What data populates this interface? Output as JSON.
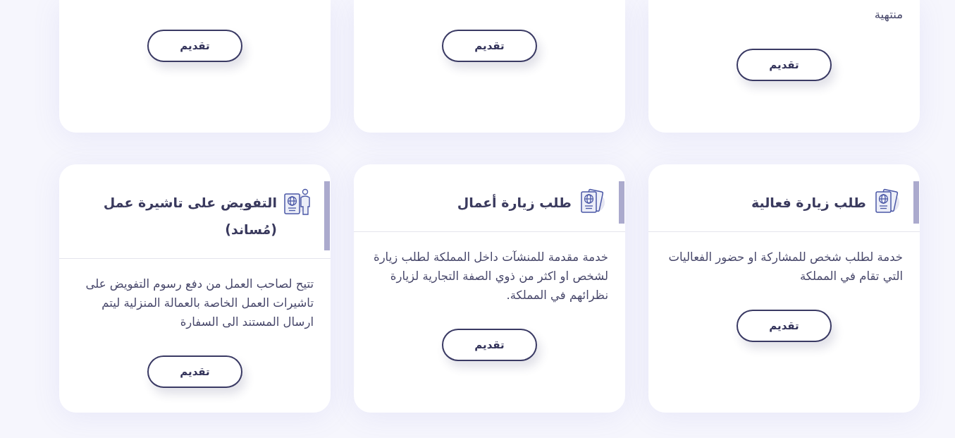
{
  "top_row_cards": [
    {
      "description": "منتهية",
      "button": "تقديم"
    },
    {
      "button": "تقديم"
    },
    {
      "button": "تقديم"
    }
  ],
  "service_cards": [
    {
      "kind": "passport",
      "title": "طلب زيارة فعالية",
      "description": "خدمة لطلب شخص للمشاركة او حضور الفعاليات التي تقام في المملكة",
      "button": "تقديم"
    },
    {
      "kind": "passport",
      "title": "طلب زيارة أعمال",
      "description": "خدمة مقدمة للمنشآت داخل المملكة لطلب زيارة لشخص او اكثر من ذوي الصفة التجارية لزيارة نظرائهم في المملكة.",
      "button": "تقديم"
    },
    {
      "kind": "passport_holder",
      "title": "التفويض على تاشيرة عمل (مُساند)",
      "description": "تتيح لصاحب العمل من دفع رسوم التفويض على تاشيرات العمل الخاصة بالعمالة المنزلية ليتم ارسال المستند الى السفارة",
      "button": "تقديم"
    }
  ]
}
